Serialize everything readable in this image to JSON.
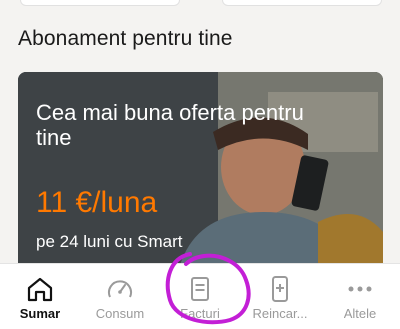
{
  "section": {
    "title": "Abonament pentru tine"
  },
  "promo": {
    "headline": "Cea mai buna oferta pentru tine",
    "price": "11 €/luna",
    "subtitle": "pe 24 luni cu Smart",
    "accent_color": "#ff7900"
  },
  "bottom_nav": {
    "active": "Sumar",
    "items": [
      {
        "label": "Sumar",
        "icon": "home-icon"
      },
      {
        "label": "Consum",
        "icon": "gauge-icon"
      },
      {
        "label": "Facturi",
        "icon": "invoice-icon"
      },
      {
        "label": "Reincar...",
        "icon": "phone-topup-icon"
      },
      {
        "label": "Altele",
        "icon": "more-dots-icon"
      }
    ]
  },
  "annotation": {
    "color": "#c31fd6",
    "shape": "hand-drawn circle around Facturi"
  }
}
